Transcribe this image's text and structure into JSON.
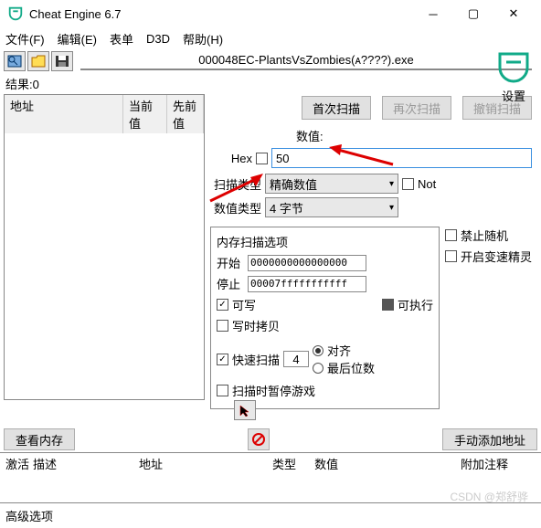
{
  "window": {
    "title": "Cheat Engine 6.7"
  },
  "menu": {
    "file": "文件(F)",
    "edit": "编辑(E)",
    "table": "表单",
    "d3d": "D3D",
    "help": "帮助(H)"
  },
  "process": {
    "label": "000048EC-PlantsVsZombies(ᴀ????).exe"
  },
  "logo_caption": "设置",
  "results": {
    "count_label": "结果:0",
    "cols": {
      "addr": "地址",
      "cur": "当前值",
      "prev": "先前值"
    }
  },
  "scan": {
    "first": "首次扫描",
    "rescan": "再次扫描",
    "undo": "撤销扫描",
    "value_label": "数值:",
    "hex": "Hex",
    "value": "50",
    "scantype_label": "扫描类型",
    "scantype": "精确数值",
    "not": "Not",
    "valtype_label": "数值类型",
    "valtype": "4 字节"
  },
  "memopts": {
    "title": "内存扫描选项",
    "start_label": "开始",
    "start": "0000000000000000",
    "stop_label": "停止",
    "stop": "00007fffffffffff",
    "writable": "可写",
    "executable": "可执行",
    "cow": "写时拷贝",
    "fastscan": "快速扫描",
    "fastscan_val": "4",
    "aligned": "对齐",
    "lastdigit": "最后位数",
    "pause": "扫描时暂停游戏",
    "no_random": "禁止随机",
    "speedhack": "开启变速精灵"
  },
  "bottom": {
    "viewmem": "查看内存",
    "addmanual": "手动添加地址"
  },
  "addrlist": {
    "active": "激活",
    "desc": "描述",
    "addr": "地址",
    "type": "类型",
    "value": "数值",
    "notes": "附加注释"
  },
  "adv": {
    "label": "高级选项"
  },
  "watermark": "CSDN @郑舒骅"
}
